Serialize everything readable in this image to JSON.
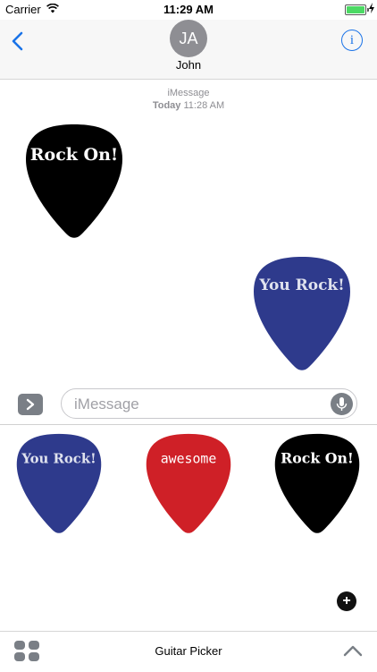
{
  "status_bar": {
    "carrier": "Carrier",
    "time": "11:29 AM"
  },
  "nav": {
    "avatar_initials": "JA",
    "contact_name": "John"
  },
  "conversation": {
    "service_label": "iMessage",
    "timestamp_day": "Today",
    "timestamp_time": "11:28 AM",
    "messages": [
      {
        "sender": "received",
        "sticker": "Rock On!",
        "color": "#000000"
      },
      {
        "sender": "sent",
        "sticker": "You Rock!",
        "color": "#2e3a8c"
      }
    ]
  },
  "input": {
    "placeholder": "iMessage"
  },
  "drawer": {
    "stickers": [
      {
        "label": "You Rock!",
        "color": "#2e3a8c"
      },
      {
        "label": "awesome",
        "color": "#cf2027"
      },
      {
        "label": "Rock On!",
        "color": "#000000"
      }
    ]
  },
  "bottom_bar": {
    "title": "Guitar Picker"
  },
  "colors": {
    "accent": "#1a73e8",
    "gray_button": "#7a7f86"
  },
  "icons": [
    "wifi-icon",
    "battery-icon",
    "back-chevron-icon",
    "info-icon",
    "apps-icon",
    "microphone-icon",
    "plus-icon",
    "app-grid-icon",
    "chevron-up-icon"
  ]
}
